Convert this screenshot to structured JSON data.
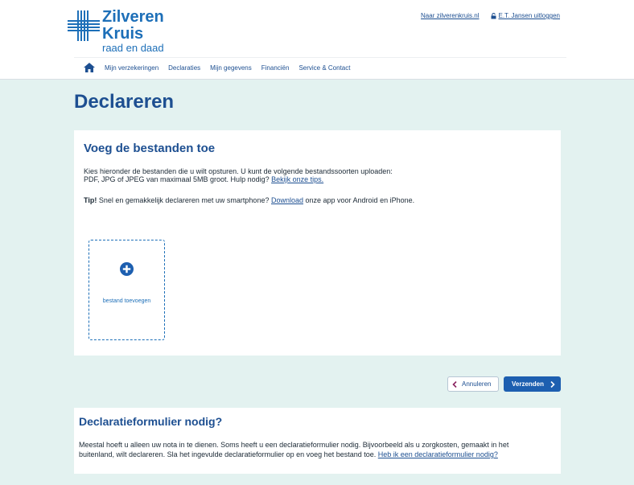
{
  "brand": {
    "name_line1": "Zilveren",
    "name_line2": "Kruis",
    "slogan": "raad en daad",
    "color": "#1d6fb8"
  },
  "toplinks": {
    "site_link": "Naar zilverenkruis.nl",
    "logout_link": "E.T. Jansen uitloggen"
  },
  "nav": {
    "items": [
      "Mijn verzekeringen",
      "Declaraties",
      "Mijn gegevens",
      "Financiën",
      "Service & Contact"
    ]
  },
  "page": {
    "title": "Declareren"
  },
  "upload_card": {
    "heading": "Voeg de bestanden toe",
    "intro_line1": "Kies hieronder de bestanden die u wilt opsturen. U kunt de volgende bestandssoorten uploaden:",
    "intro_line2": "PDF, JPG of JPEG van maximaal 5MB groot. Hulp nodig? ",
    "tips_link": "Bekijk onze tips.",
    "tip_label": "Tip!",
    "tip_text1": " Snel en gemakkelijk declareren met uw smartphone? ",
    "tip_link": "Download",
    "tip_text2": " onze app voor Android en iPhone.",
    "add_file_label": "bestand toevoegen"
  },
  "actions": {
    "cancel_label": "Annuleren",
    "send_label": "Verzenden"
  },
  "form_card": {
    "heading": "Declaratieformulier nodig?",
    "text_line1": "Meestal hoeft u alleen uw nota in te dienen. Soms heeft u een declaratieformulier nodig. Bijvoorbeeld als u zorgkosten, gemaakt in het",
    "text_line2": "buitenland, wilt declareren. Sla het ingevulde declaratieformulier op en voeg het bestand toe. ",
    "link": "Heb ik een declaratieformulier nodig?"
  },
  "colors": {
    "background": "#e3f2f0",
    "primary": "#1d4f91",
    "button": "#1d5fb0",
    "accent": "#8a2460"
  }
}
